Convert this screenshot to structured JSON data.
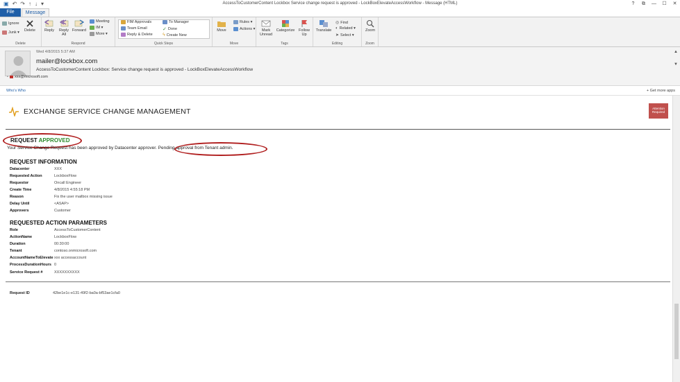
{
  "window": {
    "title": "AccessToCustomerContent Lockbox Service change request is approved - LockBoxElevateAccessWorkflow - Message (HTML)",
    "controls": [
      "?",
      "⧉",
      "—",
      "☐",
      "✕"
    ]
  },
  "tabs": [
    {
      "label": "File"
    },
    {
      "label": "Message"
    }
  ],
  "ribbon": {
    "delete_group": {
      "label": "Delete",
      "ignore": "Ignore",
      "junk": "Junk ▾",
      "delete": "Delete"
    },
    "respond_group": {
      "label": "Respond",
      "reply": "Reply",
      "reply_all": "Reply All",
      "forward": "Forward",
      "meeting": "Meeting",
      "im": "IM ▾",
      "more": "More ▾"
    },
    "quicksteps_group": {
      "label": "Quick Steps",
      "items": [
        "FIM Approvals",
        "Team Email",
        "Reply & Delete",
        "To Manager",
        "Done",
        "Create New"
      ]
    },
    "move_group": {
      "label": "Move",
      "move": "Move",
      "rules": "Rules ▾",
      "actions": "Actions ▾"
    },
    "tags_group": {
      "label": "Tags",
      "mark_unread": "Mark Unread",
      "categorize": "Categorize",
      "follow_up": "Follow Up"
    },
    "editing_group": {
      "label": "Editing",
      "translate": "Translate",
      "find": "Find",
      "related": "Related ▾",
      "select": "Select ▾"
    },
    "zoom_group": {
      "label": "Zoom",
      "zoom": "Zoom"
    }
  },
  "mail": {
    "date": "Wed 4/8/2015 5:37 AM",
    "sender": "mailer@lockbox.com",
    "subject": "AccessToCustomerContent Lockbox: Service change request is  approved  - LockBoxElevateAccessWorkflow",
    "to": "xxx@microsoft.com"
  },
  "appsbar": {
    "whowho": "Who's Who",
    "getapps": "Get more apps"
  },
  "body": {
    "brand_title": "EXCHANGE SERVICE CHANGE MANAGEMENT",
    "attention": "Attention Required",
    "request_label": "REQUEST",
    "approved_label": "APPROVED",
    "status_prefix": "Your Service Change Request has been approved by Datacenter approver.",
    "status_pending": "Pending approval from Tenant admin.",
    "request_info_title": "REQUEST INFORMATION",
    "request_info": [
      {
        "k": "Datacenter",
        "v": "XXX"
      },
      {
        "k": "Requested Action",
        "v": "LockboxFlow"
      },
      {
        "k": "Requestor",
        "v": "Oncall Engineer"
      },
      {
        "k": "Create Time",
        "v": "4/8/2015 4:55:18 PM"
      },
      {
        "k": "Reason",
        "v": "Fix the user mailbox missing issue"
      },
      {
        "k": "Delay Until",
        "v": "<ASAP>"
      },
      {
        "k": "Approvers",
        "v": "Customer"
      }
    ],
    "action_params_title": "REQUESTED ACTION PARAMETERS",
    "action_params": [
      {
        "k": "Role",
        "v": "AccessToCustomerContent"
      },
      {
        "k": "ActionName",
        "v": "LockboxFlow"
      },
      {
        "k": "Duration",
        "v": "00:30:00"
      },
      {
        "k": "Tenant",
        "v": "contoso.onmicrosoft.com"
      },
      {
        "k": "AccountNameToElevate",
        "v": "xxx accessaccount"
      },
      {
        "k": "ProcessDurationHours",
        "v": "0"
      }
    ],
    "service_request": {
      "k": "Service Request #",
      "v": "XXXXXXXXXX"
    },
    "request_id": {
      "k": "Request ID",
      "v": "42be1e1c-e131-49f2-ba0a-bf53ae1cfa0"
    }
  }
}
